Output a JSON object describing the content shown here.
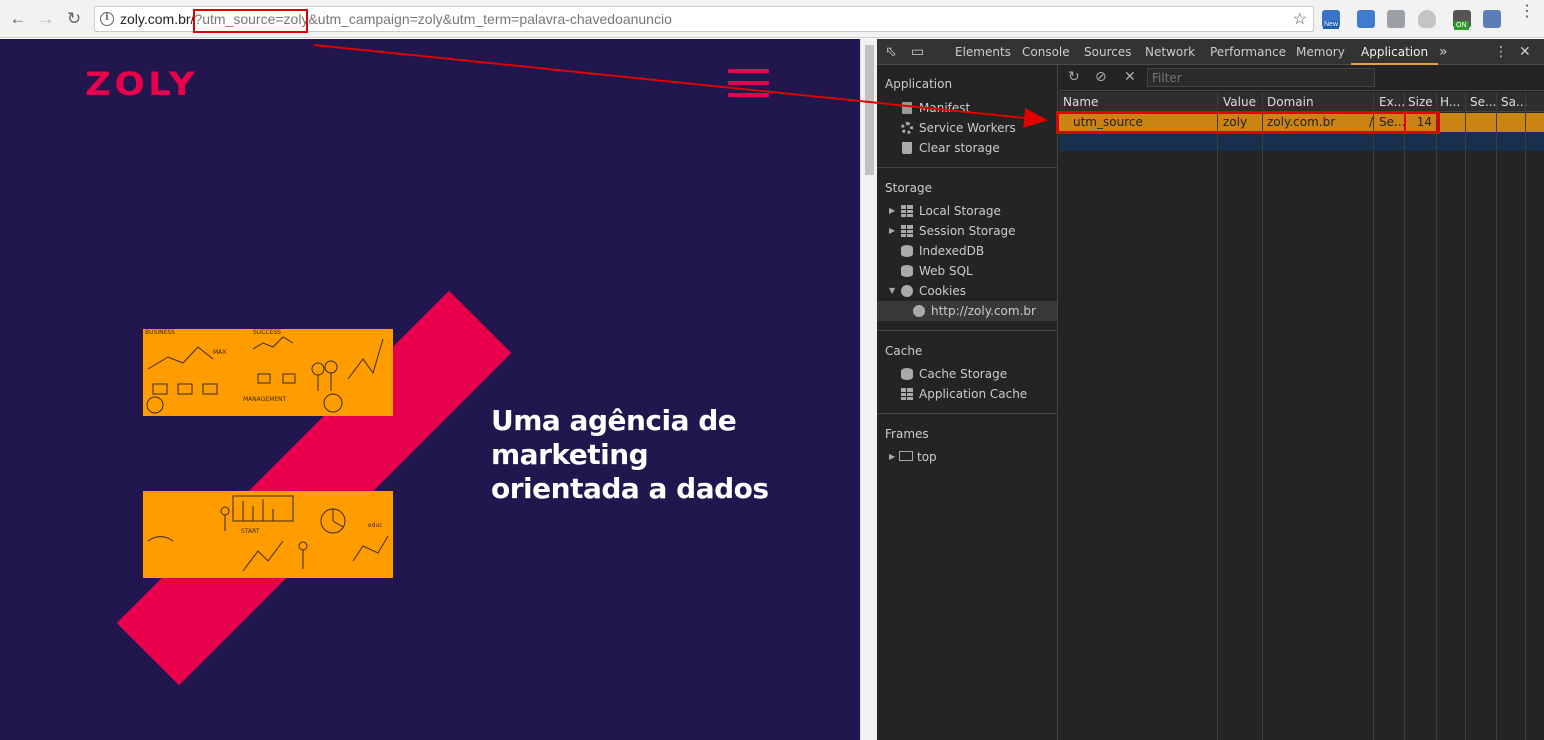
{
  "browser": {
    "url_host": "zoly.com.br/",
    "url_rest": "?utm_source=zoly&utm_campaign=zoly&utm_term=palavra-chavedoanuncio",
    "extensions": [
      {
        "name": "new-badge-extension",
        "badge": "New",
        "color": "#3b73c8"
      },
      {
        "name": "bitwarden-extension",
        "color": "#3d7ccf"
      },
      {
        "name": "pin-extension",
        "color": "#9aa0a6"
      },
      {
        "name": "shield-extension",
        "color": "#c4c4c4"
      },
      {
        "name": "lock-on-extension",
        "badge": "ON",
        "color": "#555555"
      },
      {
        "name": "code-extension",
        "color": "#5b7db8"
      }
    ]
  },
  "site": {
    "logo": "ZOLY",
    "headline_line1": "Uma agência de",
    "headline_line2": "marketing",
    "headline_line3": "orientada a dados",
    "brand_color": "#e9004c",
    "bg_color": "#21174e",
    "sketch_color": "#ff9d00"
  },
  "devtools": {
    "tabs": [
      "Elements",
      "Console",
      "Sources",
      "Network",
      "Performance",
      "Memory",
      "Application"
    ],
    "active_tab": "Application",
    "more_tabs": "»",
    "sidebar": {
      "application_header": "Application",
      "application_items": [
        "Manifest",
        "Service Workers",
        "Clear storage"
      ],
      "storage_header": "Storage",
      "storage_items": [
        "Local Storage",
        "Session Storage",
        "IndexedDB",
        "Web SQL",
        "Cookies"
      ],
      "cookie_origin": "http://zoly.com.br",
      "cache_header": "Cache",
      "cache_items": [
        "Cache Storage",
        "Application Cache"
      ],
      "frames_header": "Frames",
      "frames_items": [
        "top"
      ]
    },
    "filter_placeholder": "Filter",
    "columns": [
      "Name",
      "Value",
      "Domain",
      "/",
      "Ex...",
      "Size",
      "H...",
      "Se...",
      "Sa..."
    ],
    "cookies": [
      {
        "name": "utm_source",
        "value": "zoly",
        "domain": "zoly.com.br",
        "path": "/",
        "expires": "Se...",
        "size": "14",
        "http": "",
        "secure": "",
        "samesite": ""
      }
    ]
  }
}
